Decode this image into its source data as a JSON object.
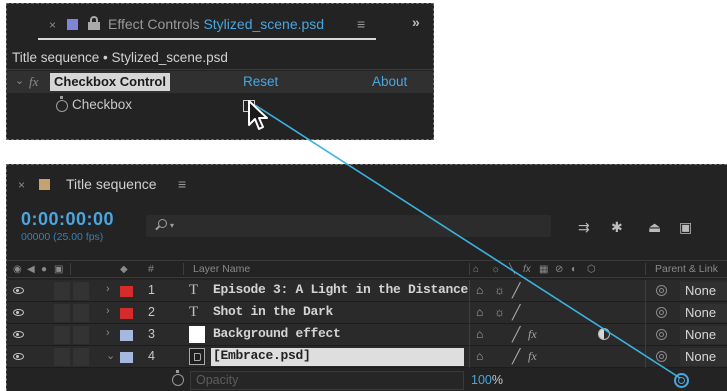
{
  "effect_controls": {
    "tab": {
      "close": "×",
      "prefix": "Effect Controls ",
      "file": "Stylized_scene.psd",
      "menu": "≡",
      "overflow": "»",
      "swatch_color": "#7f86d8"
    },
    "breadcrumb": "Title sequence • Stylized_scene.psd",
    "effect": {
      "chevron": "⌄",
      "fx": "fx",
      "name": "Checkbox Control",
      "reset": "Reset",
      "about": "About"
    },
    "property": {
      "label": "Checkbox"
    }
  },
  "timeline": {
    "close": "×",
    "title": "Title sequence",
    "menu": "≡",
    "swatch_color": "#c4a371",
    "timecode": "0:00:00:00",
    "frames": "00000 (25.00 fps)",
    "search_caret": "▾",
    "columns": {
      "hash": "#",
      "layer_name": "Layer Name",
      "parent": "Parent & Link"
    },
    "layers": [
      {
        "num": "1",
        "type_glyph": "T",
        "name": "Episode 3: A Light in the Distance",
        "label_color": "#d42b2b",
        "parent": "None"
      },
      {
        "num": "2",
        "type_glyph": "T",
        "name": "Shot in the Dark",
        "label_color": "#d42b2b",
        "parent": "None"
      },
      {
        "num": "3",
        "type_glyph": "",
        "name": "Background effect",
        "label_color": "#a7b8e0",
        "parent": "None"
      },
      {
        "num": "4",
        "type_glyph": "",
        "name": "[Embrace.psd]",
        "label_color": "#a7b8e0",
        "parent": "None"
      }
    ],
    "opacity": {
      "label": "Opacity",
      "value": "100",
      "unit": "%"
    }
  },
  "colors": {
    "accent_blue": "#4aa6e0",
    "panel_bg": "#232323",
    "pickwhip_line": "#3ab3e0"
  }
}
